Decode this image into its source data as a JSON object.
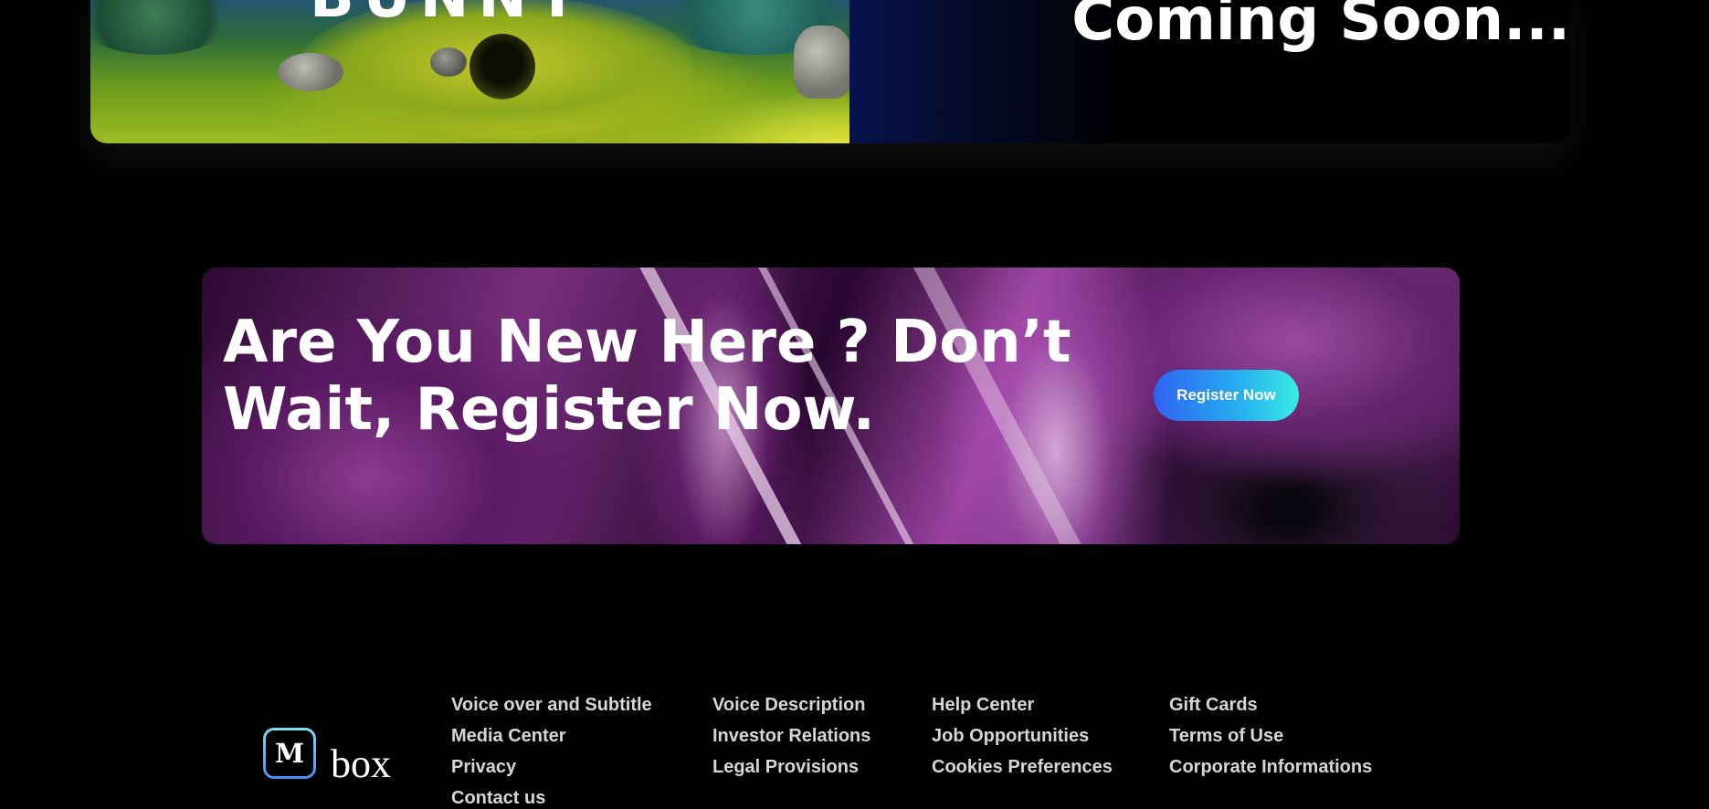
{
  "feature": {
    "movie_logo": "BUNNY",
    "coming_soon": "Coming Soon..."
  },
  "banner": {
    "heading": "Are You New Here ? Don’t Wait, Register Now.",
    "button_label": "Register Now"
  },
  "logo": {
    "mark": "M",
    "word": "box"
  },
  "footer": {
    "columns": [
      [
        "Voice over and Subtitle",
        "Media Center",
        "Privacy",
        "Contact us"
      ],
      [
        "Voice Description",
        "Investor Relations",
        "Legal Provisions"
      ],
      [
        "Help Center",
        "Job Opportunities",
        "Cookies Preferences"
      ],
      [
        "Gift Cards",
        "Terms of Use",
        "Corporate Informations"
      ]
    ]
  },
  "colors": {
    "background": "#000000",
    "button_gradient_start": "#2f63f3",
    "button_gradient_end": "#38ece5",
    "footer_link": "#d6d6d6"
  }
}
